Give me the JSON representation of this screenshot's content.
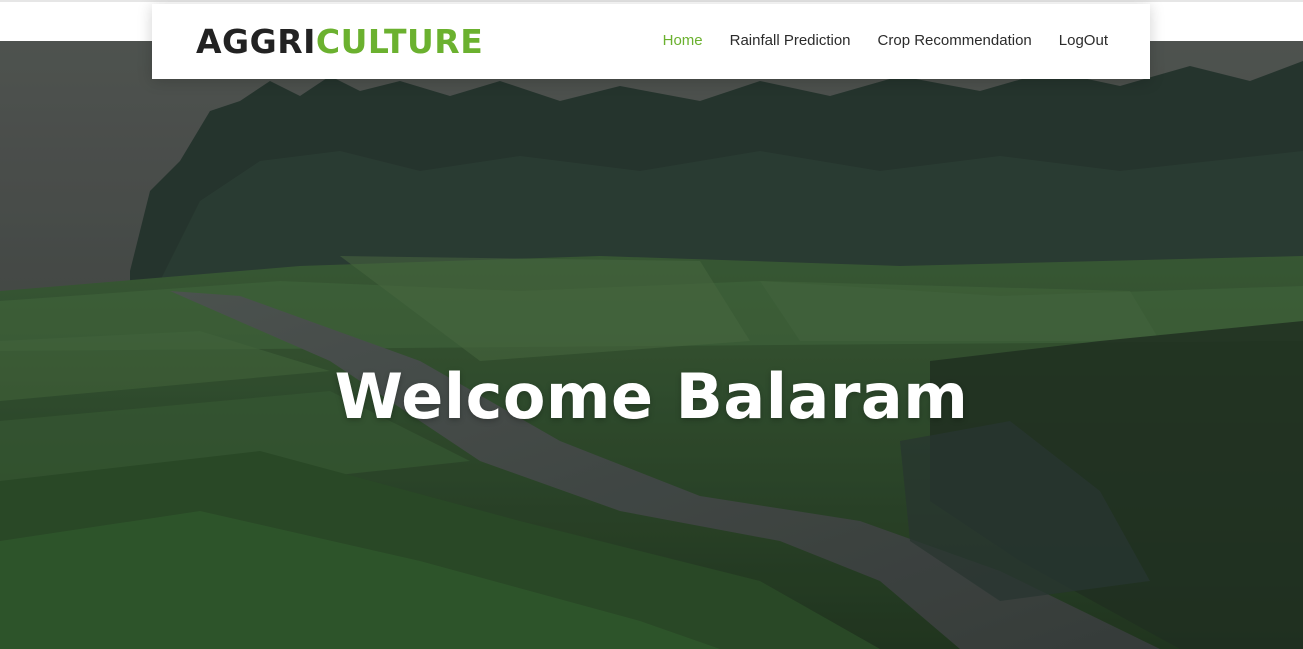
{
  "brand": {
    "part1": "AGGRI",
    "part2": "CULTURE"
  },
  "nav": {
    "items": [
      {
        "label": "Home",
        "active": true
      },
      {
        "label": "Rainfall Prediction",
        "active": false
      },
      {
        "label": "Crop Recommendation",
        "active": false
      },
      {
        "label": "LogOut",
        "active": false
      }
    ]
  },
  "hero": {
    "heading": "Welcome Balaram"
  },
  "colors": {
    "accent": "#6bb12f",
    "dark_text": "#222222"
  }
}
